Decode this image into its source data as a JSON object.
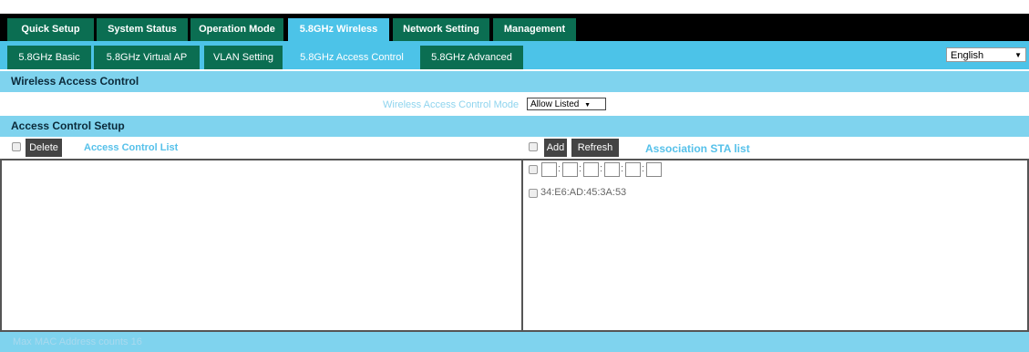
{
  "main_nav": [
    {
      "label": "Quick Setup",
      "active": false
    },
    {
      "label": "System Status",
      "active": false
    },
    {
      "label": "Operation Mode",
      "active": false
    },
    {
      "label": "5.8GHz Wireless",
      "active": true
    },
    {
      "label": "Network Setting",
      "active": false
    },
    {
      "label": "Management",
      "active": false
    }
  ],
  "sub_nav": [
    {
      "label": "5.8GHz Basic",
      "active": false
    },
    {
      "label": "5.8GHz Virtual AP",
      "active": false
    },
    {
      "label": "VLAN Setting",
      "active": false
    },
    {
      "label": "5.8GHz Access Control",
      "active": true
    },
    {
      "label": "5.8GHz Advanced",
      "active": false
    }
  ],
  "language": {
    "selected": "English"
  },
  "wireless_access_control": {
    "title": "Wireless Access Control",
    "mode_label": "Wireless Access Control Mode",
    "mode_value": "Allow Listed"
  },
  "access_control_setup": {
    "title": "Access Control Setup",
    "delete_label": "Delete",
    "acl_title": "Access Control List",
    "add_label": "Add",
    "refresh_label": "Refresh",
    "sta_title": "Association STA list",
    "sta_items": [
      "34:E6:AD:45:3A:53"
    ]
  },
  "footer": {
    "text": "Max MAC Address counts 16"
  },
  "colors": {
    "accent": "#4cc3e8",
    "nav_green": "#0b6e52",
    "section": "#7fd3ee"
  }
}
